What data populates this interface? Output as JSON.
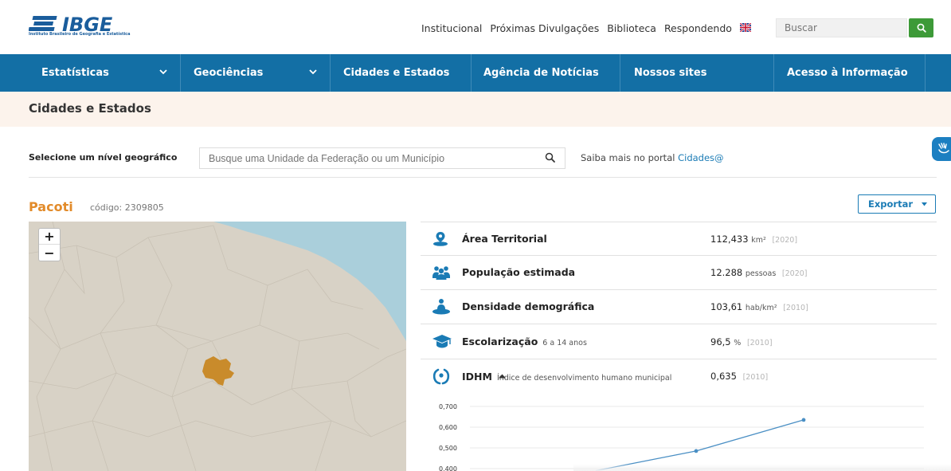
{
  "header": {
    "logo_text": "IBGE",
    "logo_subtitle": "Instituto Brasileiro de Geografia e Estatística",
    "links": [
      "Institucional",
      "Próximas Divulgações",
      "Biblioteca",
      "Respondendo"
    ],
    "search_placeholder": "Buscar"
  },
  "nav": {
    "items": [
      {
        "label": "Estatísticas",
        "has_dropdown": true
      },
      {
        "label": "Geociências",
        "has_dropdown": true
      },
      {
        "label": "Cidades e Estados",
        "has_dropdown": false
      },
      {
        "label": "Agência de Notícias",
        "has_dropdown": false
      },
      {
        "label": "Nossos sites",
        "has_dropdown": false
      },
      {
        "label": "Acesso à Informação",
        "has_dropdown": false
      }
    ]
  },
  "section_title": "Cidades e Estados",
  "selector": {
    "label": "Selecione um nível geográfico",
    "placeholder": "Busque uma Unidade da Federação ou um Município",
    "saiba_text": "Saiba mais no portal",
    "saiba_link": "Cidades@"
  },
  "municipality": {
    "name": "Pacoti",
    "code_label": "código: 2309805"
  },
  "export_label": "Exportar",
  "map": {
    "zoom_in": "+",
    "zoom_out": "−",
    "sea_color": "#aacfdb",
    "land_color": "#d8d2c6",
    "highlight_color": "#c98b2b"
  },
  "indicators": [
    {
      "icon": "location-pin-icon",
      "title": "Área Territorial",
      "subtitle": "",
      "value": "112,433",
      "unit": "km²",
      "year": "[2020]"
    },
    {
      "icon": "people-icon",
      "title": "População estimada",
      "subtitle": "",
      "value": "12.288",
      "unit": "pessoas",
      "year": "[2020]"
    },
    {
      "icon": "person-density-icon",
      "title": "Densidade demográfica",
      "subtitle": "",
      "value": "103,61",
      "unit": "hab/km²",
      "year": "[2010]"
    },
    {
      "icon": "graduation-cap-icon",
      "title": "Escolarização",
      "subtitle": "6 a 14 anos",
      "value": "96,5",
      "unit": "%",
      "year": "[2010]"
    },
    {
      "icon": "laurel-icon",
      "title": "IDHM",
      "subtitle": "Índice de desenvolvimento humano municipal",
      "value": "0,635",
      "unit": "",
      "year": "[2010]"
    }
  ],
  "chart_data": {
    "type": "line",
    "y_ticks": [
      "0,700",
      "0,600",
      "0,500",
      "0,400"
    ],
    "ylim": [
      0.4,
      0.7
    ],
    "series": [
      {
        "values": [
          0.39,
          0.485,
          0.635
        ]
      }
    ],
    "line_color": "#4a8fc4"
  }
}
